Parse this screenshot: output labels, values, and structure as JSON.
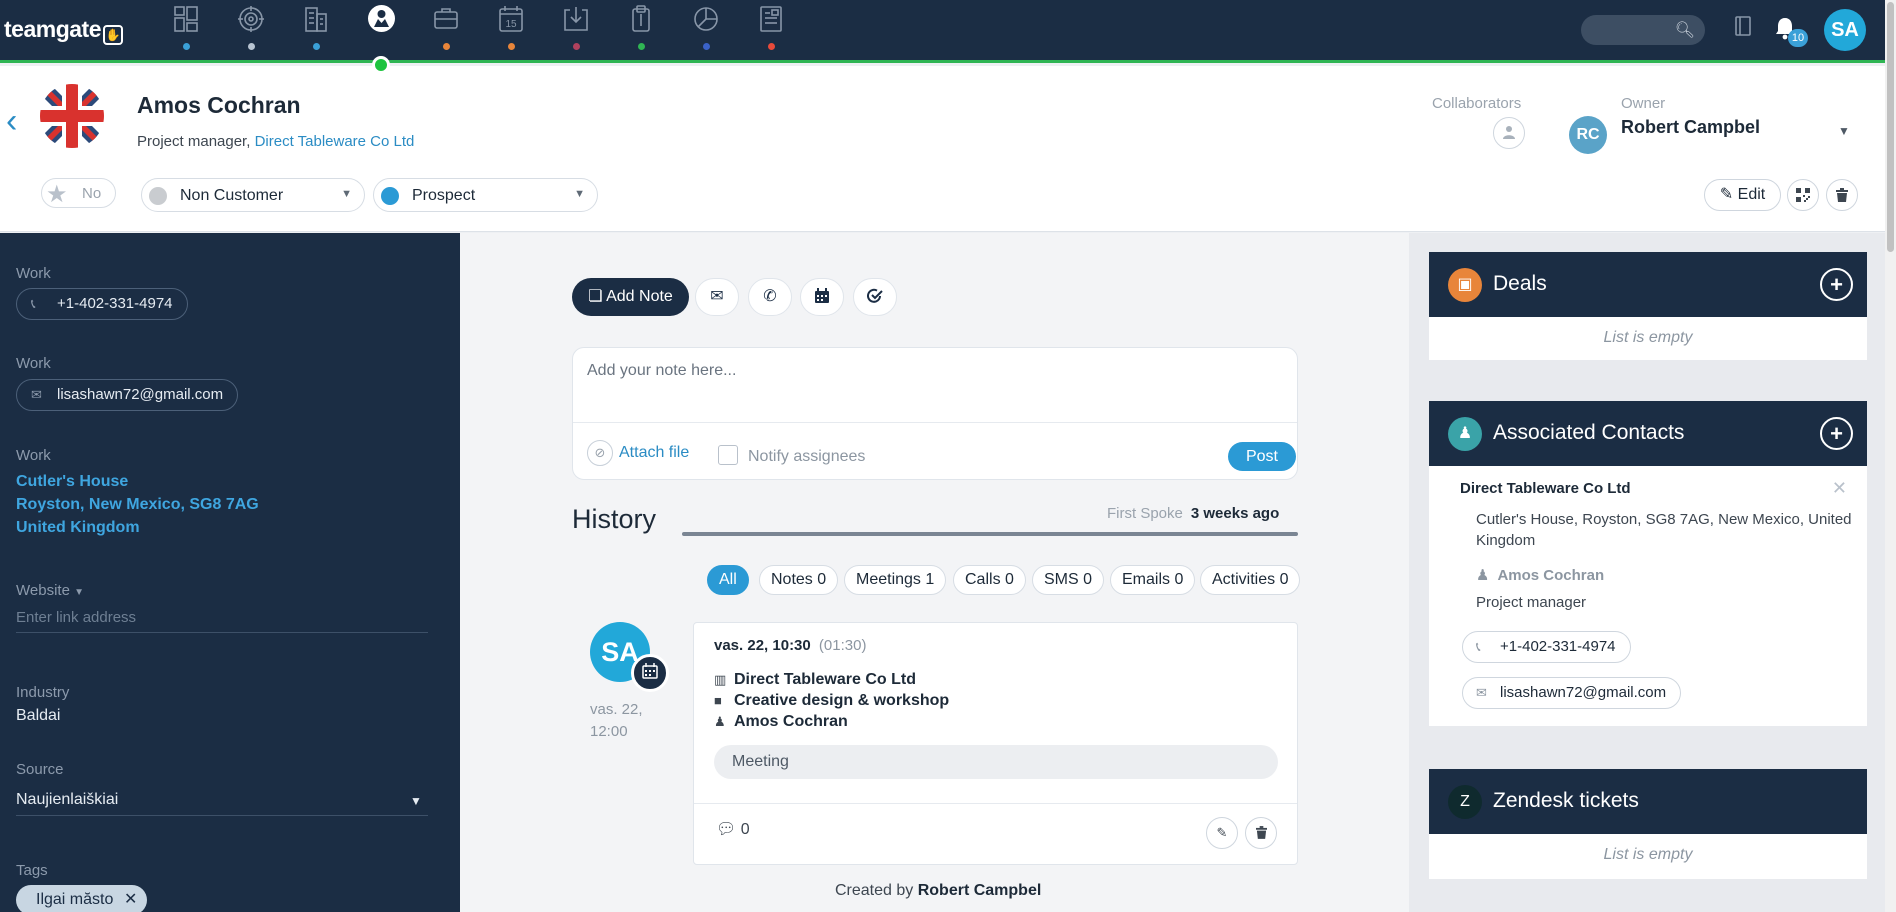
{
  "app": {
    "logo": "teamgate"
  },
  "topnav": {
    "items": [
      {
        "name": "dashboard-icon",
        "dot": "#3aa0d8"
      },
      {
        "name": "target-icon",
        "dot": "#b8c4d2"
      },
      {
        "name": "companies-icon",
        "dot": "#3aa0d8"
      },
      {
        "name": "contacts-icon",
        "dot": "#2fb553",
        "active": true
      },
      {
        "name": "deals-icon",
        "dot": "#e8853a"
      },
      {
        "name": "calendar-icon",
        "dot": "#e8853a",
        "text": "15"
      },
      {
        "name": "inbox-icon",
        "dot": "#b0415e"
      },
      {
        "name": "documents-icon",
        "dot": "#2fb553"
      },
      {
        "name": "reports-icon",
        "dot": "#3a62c8"
      },
      {
        "name": "invoices-icon",
        "dot": "#e84a3a"
      }
    ],
    "notifications_count": "10",
    "user_initials": "SA"
  },
  "contact": {
    "name": "Amos Cochran",
    "role": "Project manager,",
    "company": "Direct Tableware Co Ltd",
    "star_label": "No",
    "status": "Non Customer",
    "status_color": "#c9ccd0",
    "stage": "Prospect",
    "stage_color": "#2b9ad5",
    "collaborators_label": "Collaborators",
    "owner_label": "Owner",
    "owner_initials": "RC",
    "owner_name": "Robert Campbel",
    "edit_label": "Edit"
  },
  "sidebar": {
    "phone_label": "Work",
    "phone": "+1-402-331-4974",
    "email_label": "Work",
    "email": "lisashawn72@gmail.com",
    "address_label": "Work",
    "address_line1": "Cutler's House",
    "address_line2": "Royston, New Mexico, SG8 7AG",
    "address_line3": "United Kingdom",
    "website_label": "Website",
    "website_placeholder": "Enter link address",
    "industry_label": "Industry",
    "industry": "Baldai",
    "source_label": "Source",
    "source": "Naujienlaiškiai",
    "tags_label": "Tags",
    "tag": "Ilgai măsto"
  },
  "composer": {
    "add_note_label": "Add Note",
    "placeholder": "Add your note here...",
    "attach_label": "Attach file",
    "notify_label": "Notify assignees",
    "post_label": "Post"
  },
  "history": {
    "title": "History",
    "first_spoke_label": "First Spoke",
    "first_spoke_value": "3 weeks ago",
    "filters": [
      "All",
      "Notes 0",
      "Meetings 1",
      "Calls 0",
      "SMS 0",
      "Emails 0",
      "Activities 0"
    ],
    "entry": {
      "initials": "SA",
      "date_line1": "vas. 22,",
      "date_line2": "12:00",
      "time": "vas. 22, 10:30",
      "duration": "(01:30)",
      "company": "Direct Tableware Co Ltd",
      "deal": "Creative design & workshop",
      "person": "Amos Cochran",
      "type": "Meeting",
      "comments": "0"
    },
    "created_prefix": "Created by",
    "created_by": "Robert Campbel"
  },
  "right": {
    "deals_title": "Deals",
    "deals_empty": "List is empty",
    "assoc_title": "Associated Contacts",
    "assoc_company": "Direct Tableware Co Ltd",
    "assoc_address": "Cutler's House, Royston, SG8 7AG, New Mexico, United Kingdom",
    "assoc_person": "Amos Cochran",
    "assoc_role": "Project manager",
    "assoc_phone": "+1-402-331-4974",
    "assoc_email": "lisashawn72@gmail.com",
    "zendesk_title": "Zendesk tickets",
    "zendesk_empty": "List is empty"
  }
}
